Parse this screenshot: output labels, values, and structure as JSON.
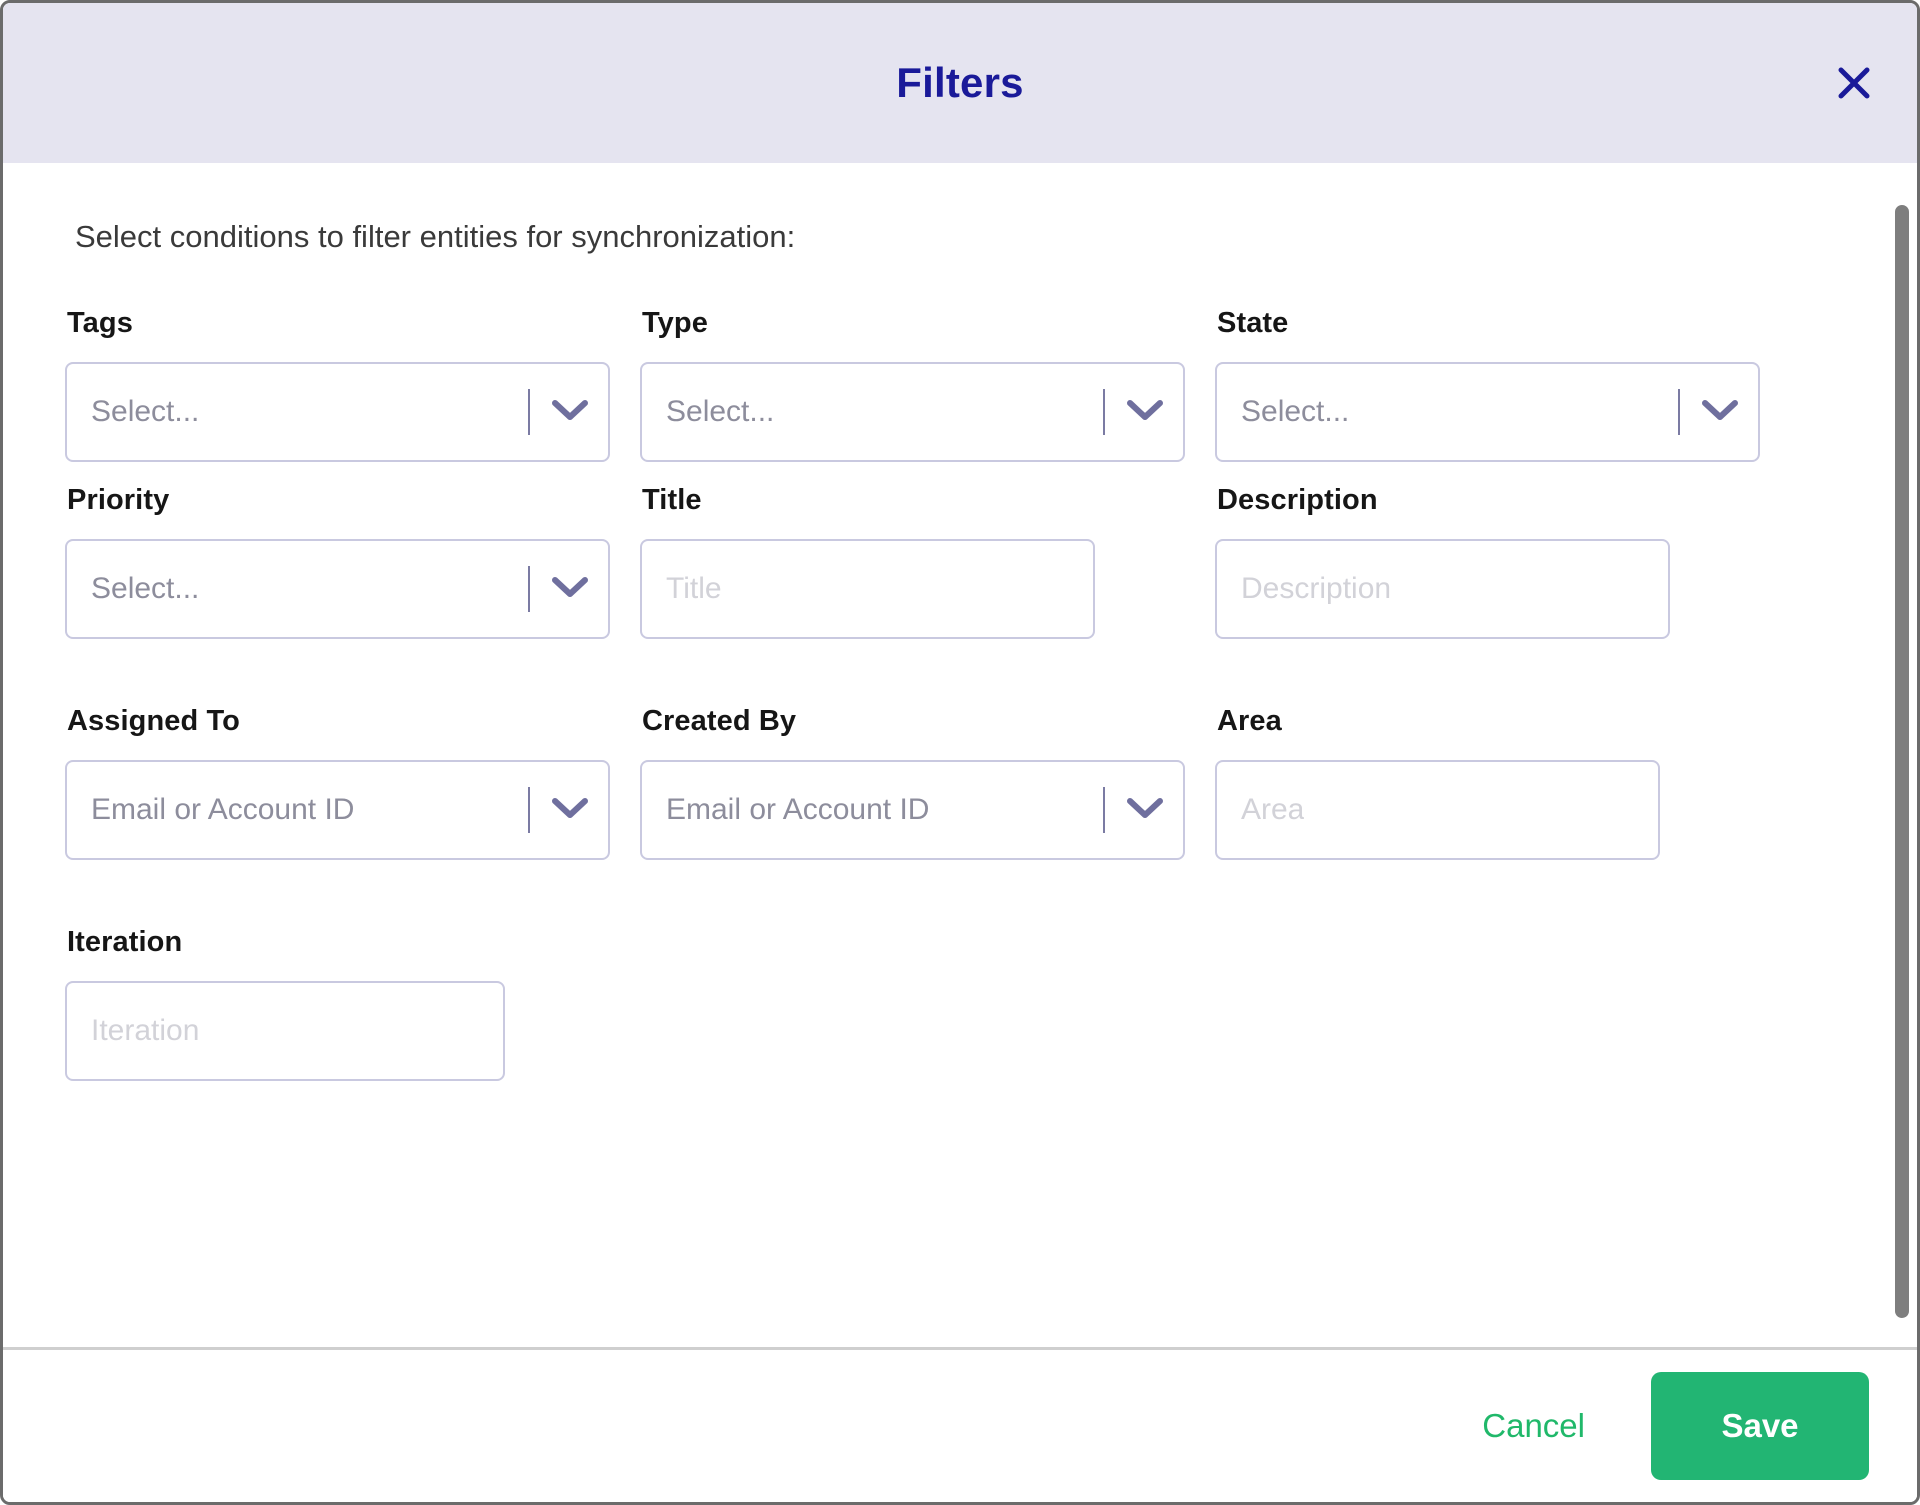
{
  "dialog": {
    "title": "Filters",
    "close_icon": "close-icon",
    "intro": "Select conditions to filter entities for synchronization:"
  },
  "colors": {
    "header_bg": "#e5e4f0",
    "title": "#1a1a99",
    "accent_green": "#22b573",
    "cancel_green": "#20b86a",
    "field_border": "#c9c9e0",
    "chevron": "#6f6f9e"
  },
  "fields": {
    "tags": {
      "label": "Tags",
      "placeholder": "Select...",
      "type": "select"
    },
    "type": {
      "label": "Type",
      "placeholder": "Select...",
      "type": "select"
    },
    "state": {
      "label": "State",
      "placeholder": "Select...",
      "type": "select"
    },
    "priority": {
      "label": "Priority",
      "placeholder": "Select...",
      "type": "select"
    },
    "title": {
      "label": "Title",
      "placeholder": "Title",
      "type": "text"
    },
    "description": {
      "label": "Description",
      "placeholder": "Description",
      "type": "text"
    },
    "assigned_to": {
      "label": "Assigned To",
      "placeholder": "Email or Account ID",
      "type": "select"
    },
    "created_by": {
      "label": "Created By",
      "placeholder": "Email or Account ID",
      "type": "select"
    },
    "area": {
      "label": "Area",
      "placeholder": "Area",
      "type": "text"
    },
    "iteration": {
      "label": "Iteration",
      "placeholder": "Iteration",
      "type": "text"
    }
  },
  "footer": {
    "cancel_label": "Cancel",
    "save_label": "Save"
  }
}
